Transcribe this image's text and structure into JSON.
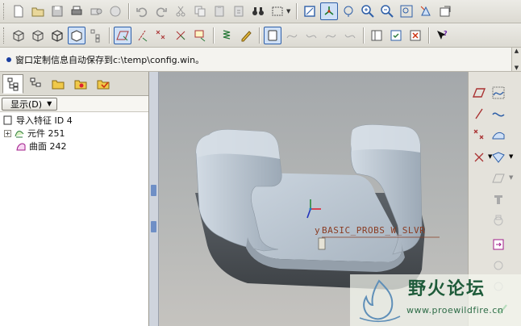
{
  "message_bar": {
    "text": "窗口定制信息自动保存到c:\\temp\\config.win。"
  },
  "navigator": {
    "show_button_label": "显示(D)",
    "tree": [
      {
        "label": "导入特征 ID 4"
      },
      {
        "label": "元件 251"
      },
      {
        "label": "曲面 242"
      }
    ]
  },
  "viewport": {
    "model_tag": "BASIC_PROBS_W_SLVR",
    "csys_label": "y"
  },
  "watermark": {
    "title": "野火论坛",
    "url": "www.proewildfire.cn"
  },
  "colors": {
    "accent": "#2e5fa8",
    "model_surface": "#b9c4cf",
    "model_shadow": "#4d5258",
    "watermark_green": "#1e5b3a"
  }
}
